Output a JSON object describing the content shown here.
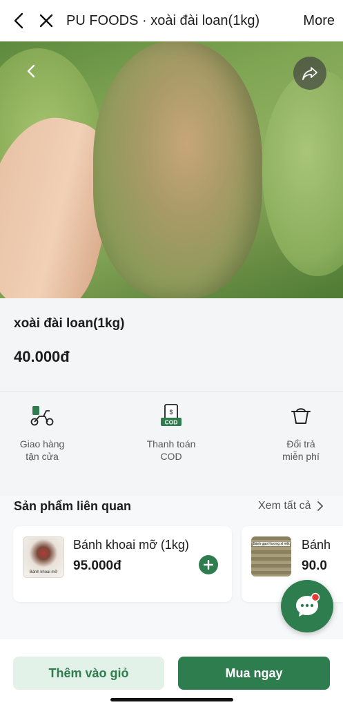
{
  "header": {
    "title": "PU FOODS · xoài đài loan(1kg)",
    "more_label": "More",
    "back_icon": "chevron-left-icon",
    "close_icon": "close-icon"
  },
  "hero": {
    "back_icon": "chevron-left-icon",
    "share_icon": "share-arrow-icon"
  },
  "product": {
    "name": "xoài đài loan(1kg)",
    "price": "40.000đ"
  },
  "features": [
    {
      "icon": "delivery-scooter-icon",
      "label": "Giao hàng\ntận cửa"
    },
    {
      "icon": "cod-payment-icon",
      "icon_text": "COD",
      "label": "Thanh toán\nCOD"
    },
    {
      "icon": "return-basket-icon",
      "label": "Đổi trả\nmiễn phí"
    }
  ],
  "related": {
    "title": "Sản phẩm liên quan",
    "see_all": "Xem tất cả",
    "items": [
      {
        "name": "Bánh khoai mỡ (1kg)",
        "price": "95.000đ",
        "thumb_text": "Bánh khoai mỡ"
      },
      {
        "name": "Bánh",
        "price": "90.0",
        "thumb_text": "Bánh gạo Hương xì việt"
      }
    ]
  },
  "actions": {
    "add_to_cart": "Thêm vào giỏ",
    "buy_now": "Mua ngay"
  },
  "colors": {
    "brand_green": "#2e7d4f",
    "light_green": "#e3f2e8",
    "notification_red": "#e53935"
  }
}
